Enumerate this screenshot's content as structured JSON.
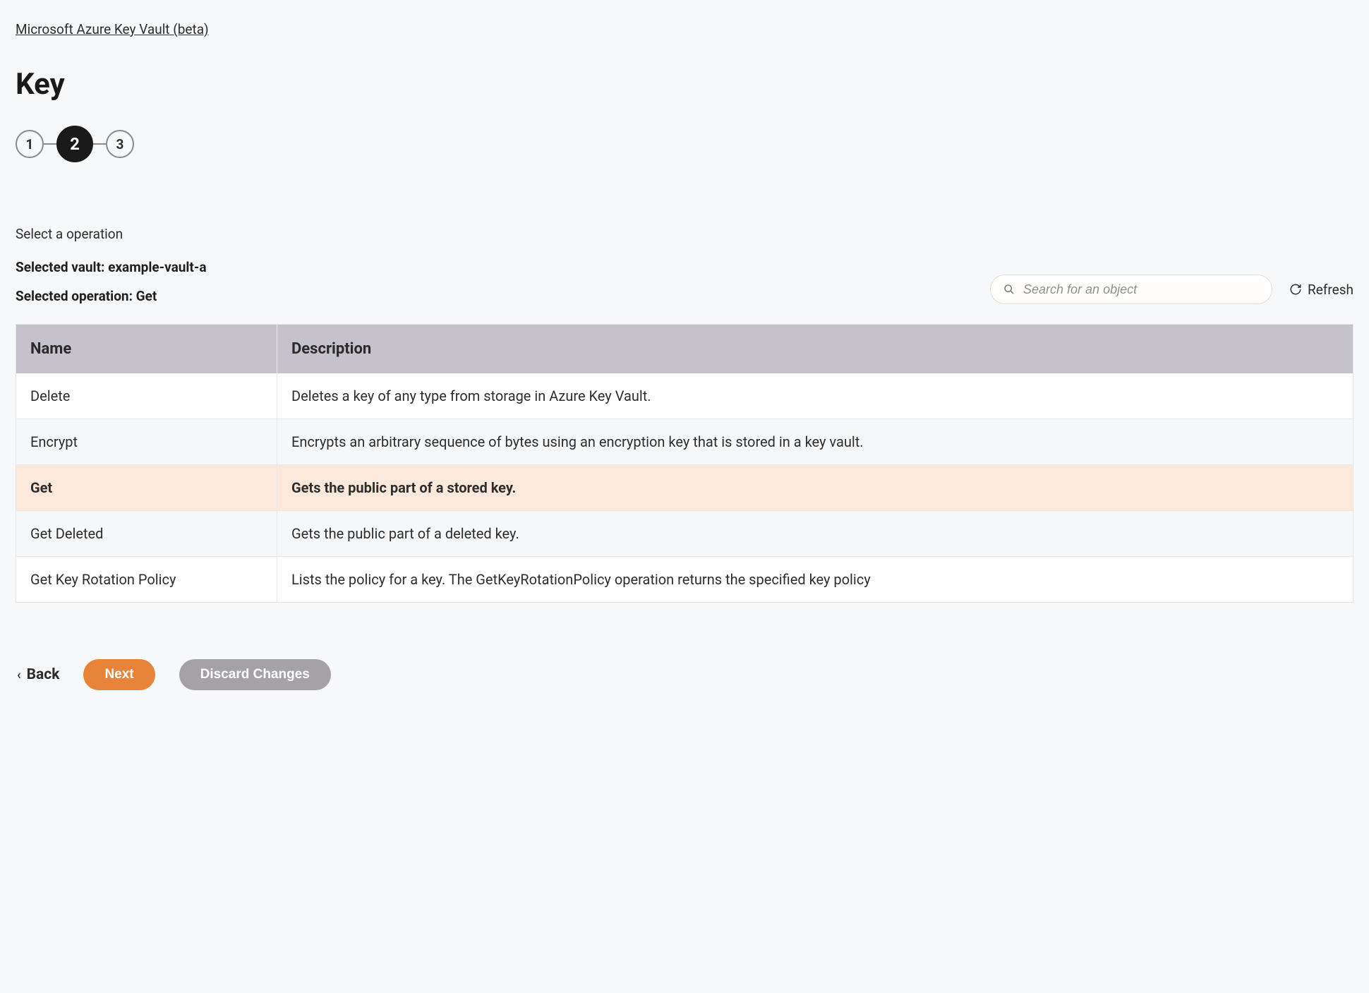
{
  "breadcrumb": {
    "label": "Microsoft Azure Key Vault (beta)"
  },
  "page_title": "Key",
  "stepper": {
    "steps": [
      "1",
      "2",
      "3"
    ],
    "active_index": 1
  },
  "instruction": "Select a operation",
  "selected": {
    "vault_label": "Selected vault:",
    "vault_value": "example-vault-a",
    "operation_label": "Selected operation:",
    "operation_value": "Get"
  },
  "search": {
    "placeholder": "Search for an object"
  },
  "refresh_label": "Refresh",
  "table": {
    "headers": {
      "name": "Name",
      "description": "Description"
    },
    "rows": [
      {
        "name": "Delete",
        "description": "Deletes a key of any type from storage in Azure Key Vault.",
        "selected": false
      },
      {
        "name": "Encrypt",
        "description": "Encrypts an arbitrary sequence of bytes using an encryption key that is stored in a key vault.",
        "selected": false
      },
      {
        "name": "Get",
        "description": "Gets the public part of a stored key.",
        "selected": true
      },
      {
        "name": "Get Deleted",
        "description": "Gets the public part of a deleted key.",
        "selected": false
      },
      {
        "name": "Get Key Rotation Policy",
        "description": "Lists the policy for a key. The GetKeyRotationPolicy operation returns the specified key policy",
        "selected": false
      }
    ]
  },
  "footer": {
    "back": "Back",
    "next": "Next",
    "discard": "Discard Changes"
  }
}
